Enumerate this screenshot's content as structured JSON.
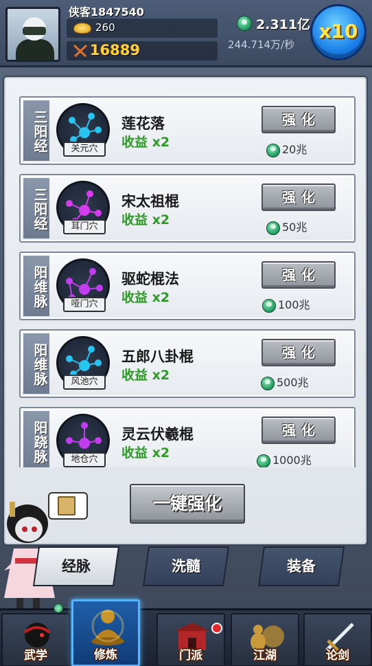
{
  "header": {
    "player_name": "侠客1847540",
    "gold": "260",
    "combat_power": "16889",
    "money": "2.311亿",
    "income_rate": "244.714万/秒",
    "multiplier_label": "x10"
  },
  "cards": [
    {
      "meridian": "三阳经",
      "acupoint": "关元穴",
      "skill": "莲花落",
      "yield": "收益 x2",
      "button": "强化",
      "cost": "20兆",
      "node_color": "#27c4f2"
    },
    {
      "meridian": "三阳经",
      "acupoint": "耳门穴",
      "skill": "宋太祖棍",
      "yield": "收益 x2",
      "button": "强化",
      "cost": "50兆",
      "node_color": "#d63cf0"
    },
    {
      "meridian": "阳维脉",
      "acupoint": "哑门穴",
      "skill": "驱蛇棍法",
      "yield": "收益 x2",
      "button": "强化",
      "cost": "100兆",
      "node_color": "#c23cf0"
    },
    {
      "meridian": "阳维脉",
      "acupoint": "风池穴",
      "skill": "五郎八卦棍",
      "yield": "收益 x2",
      "button": "强化",
      "cost": "500兆",
      "node_color": "#27c4f2"
    },
    {
      "meridian": "阳跷脉",
      "acupoint": "地仓穴",
      "skill": "灵云伏羲棍",
      "yield": "收益 x2",
      "button": "强化",
      "cost": "1000兆",
      "node_color": "#c23cf0"
    }
  ],
  "actions": {
    "one_key_upgrade": "一键强化"
  },
  "tabs": [
    "经脉",
    "洗髓",
    "装备"
  ],
  "bottom_nav": [
    "武学",
    "修炼",
    "门派",
    "江湖",
    "论剑"
  ]
}
